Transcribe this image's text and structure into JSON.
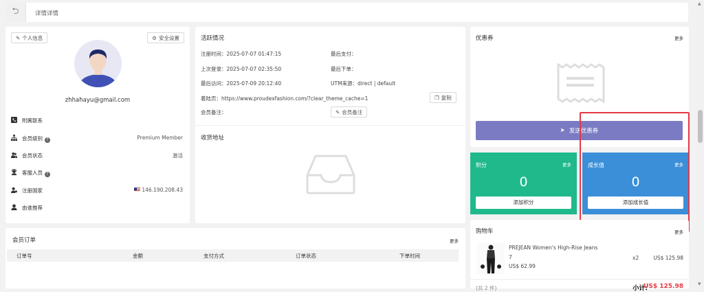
{
  "header": {
    "back_icon": "undo-arrow-icon",
    "title": "详情详情"
  },
  "profile": {
    "personal_info_label": "个人信息",
    "security_label": "安全设置",
    "email": "zhhahayu@gmail.com",
    "rows": [
      {
        "label": "附属联系",
        "value": "",
        "icon": "phone-icon"
      },
      {
        "label": "会员级别",
        "value": "Premium Member",
        "icon": "org-chart-icon",
        "help": true
      },
      {
        "label": "会员状态",
        "value": "激活",
        "icon": "users-icon"
      },
      {
        "label": "客服人员",
        "value": "",
        "icon": "support-agent-icon",
        "help": true
      },
      {
        "label": "注册国家",
        "value": "146.190.208.43",
        "icon": "user-location-icon"
      },
      {
        "label": "由谁推荐",
        "value": "",
        "icon": "user-icon"
      }
    ]
  },
  "activity": {
    "title": "活跃情况",
    "register_time": "注册时间：2025-07-07 01:47:15",
    "last_payment": "最后支付：",
    "last_login": "上次登录：2025-07-07 02:35:50",
    "last_order": "最后下单：",
    "last_visit": "最后访问：2025-07-09 20:12:40",
    "utm": "UTM来源：direct | default",
    "landing_page": "着陆页：https://www.proudexfashion.com/?clear_theme_cache=1",
    "copy_label": "复制",
    "member_note_label": "会员备注：",
    "member_note_button": "会员备注"
  },
  "address": {
    "title": "收货地址"
  },
  "coupons": {
    "title": "优惠券",
    "more": "更多",
    "send_label": "发送优惠券"
  },
  "points": {
    "title": "积分",
    "more": "更多",
    "value": "0",
    "button": "添加积分",
    "color": "#1fb98c"
  },
  "growth": {
    "title": "成长值",
    "more": "更多",
    "value": "0",
    "button": "添加成长值",
    "color": "#3a8fd8"
  },
  "cart": {
    "title": "购物车",
    "more": "更多",
    "item": {
      "name": "PREJEAN Women's High-Rise Jeans",
      "variant": "7",
      "price": "US$ 62.99",
      "qty": "x2",
      "total": "US$ 125.98"
    },
    "count": "(共 2 件)",
    "subtotal_label": "小计:",
    "subtotal_value": "US$ 125.98"
  },
  "orders": {
    "title": "会员订单",
    "more": "更多",
    "columns": [
      "订单号",
      "金额",
      "支付方式",
      "订单状态",
      "下单时间"
    ]
  },
  "colors": {
    "coupon_button": "#7a7bc2",
    "highlight": "#e53945",
    "points": "#1fb98c",
    "growth": "#3a8fd8"
  }
}
